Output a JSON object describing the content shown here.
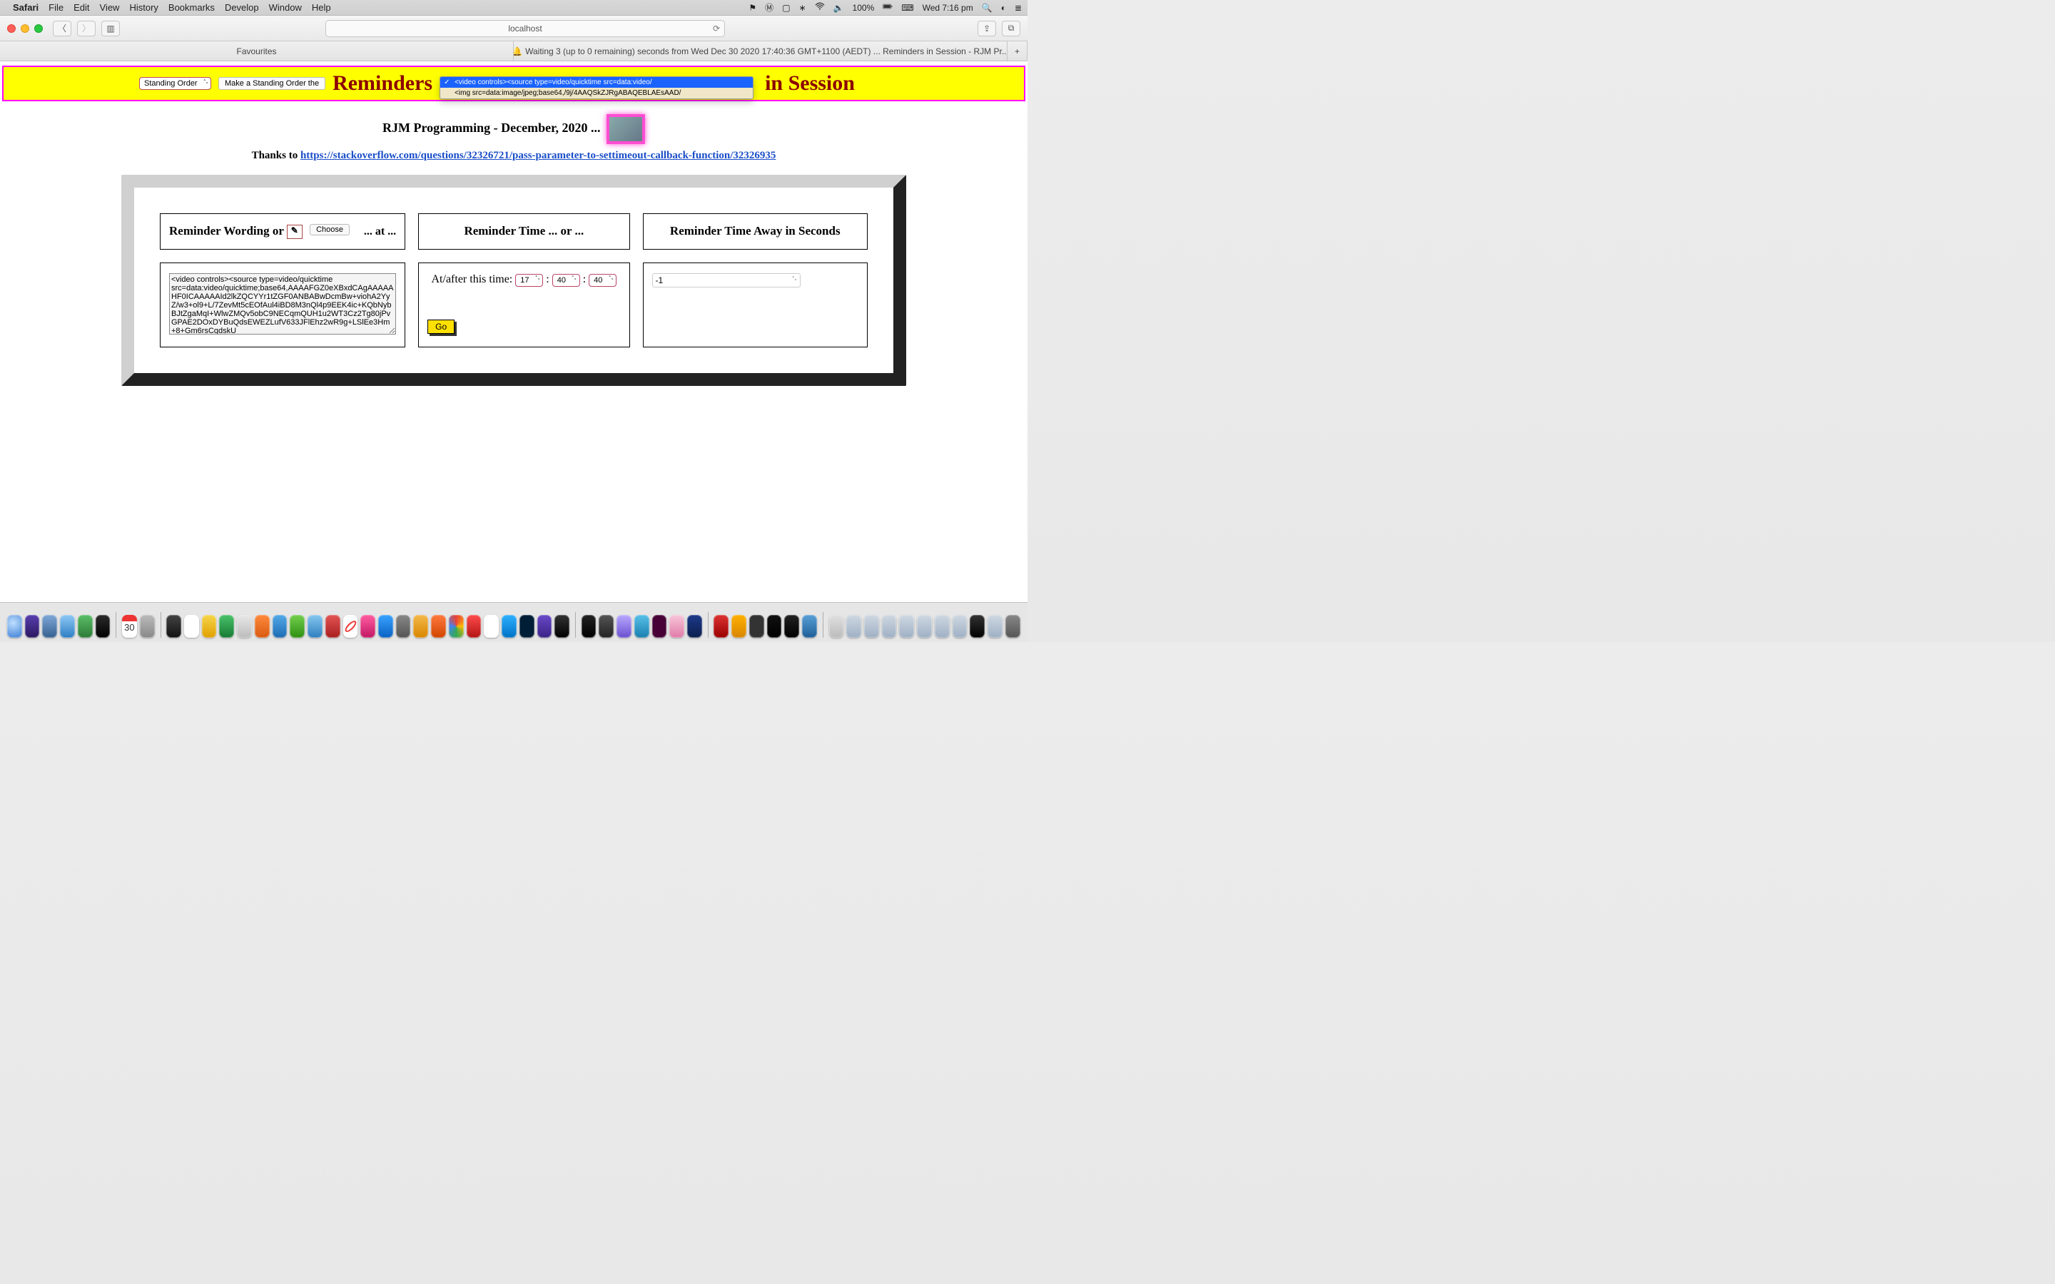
{
  "menubar": {
    "app": "Safari",
    "items": [
      "File",
      "Edit",
      "View",
      "History",
      "Bookmarks",
      "Develop",
      "Window",
      "Help"
    ],
    "battery": "100%",
    "clock": "Wed 7:16 pm"
  },
  "toolbar": {
    "address": "localhost"
  },
  "tabs": {
    "fav": "Favourites",
    "main": "Waiting 3 (up to 0 remaining) seconds from Wed Dec 30 2020 17:40:36 GMT+1100 (AEDT) ... Reminders in Session - RJM Pr...",
    "plus": "+"
  },
  "yellowbar": {
    "standing_order_select": "Standing Order",
    "make_btn": "Make a Standing Order the",
    "title_left": "Reminders",
    "title_right": "in Session",
    "dropdown": {
      "selected": "<video controls><source type=video/quicktime src=data:video/",
      "options": [
        "<video controls><source type=video/quicktime src=data:video/",
        "<img src=data:image/jpeg;base64,/9j/4AAQSkZJRgABAQEBLAEsAAD/"
      ]
    }
  },
  "subtitle": "RJM Programming - December, 2020 ...",
  "thanks_prefix": "Thanks to ",
  "thanks_link": "https://stackoverflow.com/questions/32326721/pass-parameter-to-settimeout-callback-function/32326935",
  "grid": {
    "h1_left": "Reminder Wording or ",
    "choose": "Choose",
    "at": "... at ...",
    "h2": "Reminder Time ... or ...",
    "h3": "Reminder Time Away in Seconds",
    "wording_val": "<video controls><source type=video/quicktime src=data:video/quicktime;base64,AAAAFGZ0eXBxdCAgAAAAAHF0ICAAAAAId2lkZQCYYr1tZGF0ANBABwDcmBw+viohA2YyZ/w3+ol9+L/7ZevMt5cEOfAul4iBD8M3nQl4p9EEK4ic+KQbNybBJtZgaMqI+WlwZMQv5obC9NECqmQUH1u2WT3Cz2Tg80jPvGPAE2DOxDYBuQdsEWEZLufV633JFlEhz2wR9g+LSlEe3Hm+8+Gm6rsCqdskU",
    "atafter": "At/after this time: ",
    "h": "17",
    "m": "40",
    "s": "40",
    "seconds_away": "-1",
    "go": "Go"
  },
  "dock": {
    "calendar_day": "30"
  }
}
